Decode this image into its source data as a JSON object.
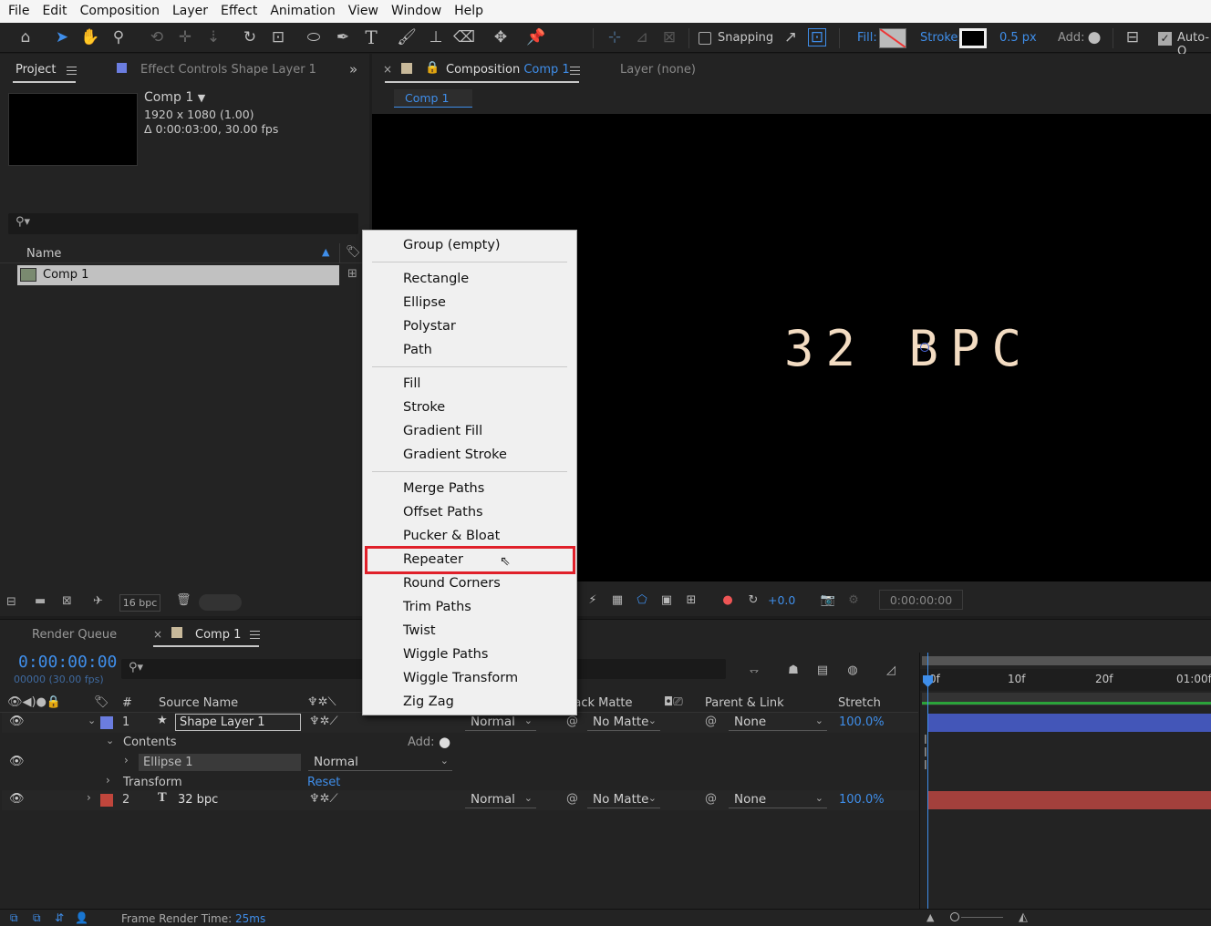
{
  "menubar": [
    "File",
    "Edit",
    "Composition",
    "Layer",
    "Effect",
    "Animation",
    "View",
    "Window",
    "Help"
  ],
  "toolbar": {
    "snapping_label": "Snapping",
    "fill_label": "Fill:",
    "stroke_label": "Stroke:",
    "stroke_width": "0.5 px",
    "add_label": "Add:",
    "auto_label": "Auto-O"
  },
  "project_panel": {
    "tab_project": "Project",
    "tab_effect_controls": "Effect Controls",
    "tab_effect_controls_layer": "Shape Layer 1",
    "comp_name": "Comp 1",
    "comp_resolution": "1920 x 1080 (1.00)",
    "comp_duration": "Δ 0:00:03:00, 30.00 fps",
    "search_placeholder": "",
    "column_name": "Name",
    "items": [
      {
        "name": "Comp 1"
      }
    ],
    "bpc_label": "16 bpc"
  },
  "composition_panel": {
    "tab_label": "Composition",
    "tab_comp_name": "Comp 1",
    "layer_tab": "Layer (none)",
    "sub_tab": "Comp 1",
    "viewer_text": "32 BPC",
    "exposure": "+0.0",
    "timecode": "0:00:00:00",
    "text_color": "#f3dcc2"
  },
  "context_menu": {
    "items": [
      {
        "label": "Group (empty)"
      },
      {
        "label": "Rectangle"
      },
      {
        "label": "Ellipse"
      },
      {
        "label": "Polystar"
      },
      {
        "label": "Path"
      },
      {
        "label": "Fill"
      },
      {
        "label": "Stroke"
      },
      {
        "label": "Gradient Fill"
      },
      {
        "label": "Gradient Stroke"
      },
      {
        "label": "Merge Paths"
      },
      {
        "label": "Offset Paths"
      },
      {
        "label": "Pucker & Bloat"
      },
      {
        "label": "Repeater"
      },
      {
        "label": "Round Corners"
      },
      {
        "label": "Trim Paths"
      },
      {
        "label": "Twist"
      },
      {
        "label": "Wiggle Paths"
      },
      {
        "label": "Wiggle Transform"
      },
      {
        "label": "Zig Zag"
      }
    ],
    "highlighted": "Repeater",
    "highlight_color": "#e0202a"
  },
  "timeline": {
    "tab_render_queue": "Render Queue",
    "tab_comp": "Comp 1",
    "timecode": "0:00:00:00",
    "frame_info": "00000 (30.00 fps)",
    "columns": {
      "number": "#",
      "source_name": "Source Name",
      "track_matte": "Track Matte",
      "parent_link": "Parent & Link",
      "stretch": "Stretch"
    },
    "ruler": [
      "0f",
      "10f",
      "20f",
      "01:00f"
    ],
    "layers": [
      {
        "index": "1",
        "name": "Shape Layer 1",
        "mode": "Normal",
        "matte": "No Matte",
        "parent": "None",
        "stretch": "100.0%",
        "label_color": "#6b7de0",
        "bar_color": "#4356b8"
      },
      {
        "index": "2",
        "name": "32 bpc",
        "mode": "Normal",
        "matte": "No Matte",
        "parent": "None",
        "stretch": "100.0%",
        "label_color": "#c0463c",
        "bar_color": "#a3403c"
      }
    ],
    "contents_label": "Contents",
    "add_label": "Add:",
    "ellipse_label": "Ellipse 1",
    "ellipse_mode": "Normal",
    "transform_label": "Transform",
    "reset_label": "Reset",
    "frame_render_label": "Frame Render Time:",
    "frame_render_value": "25ms"
  }
}
